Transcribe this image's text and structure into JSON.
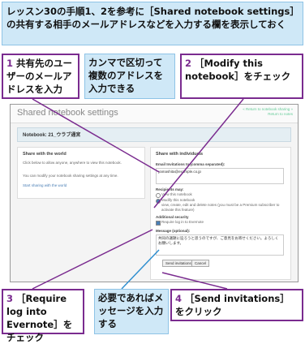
{
  "intro": "レッスン30の手順1、2を参考に［Shared notebook settings］の共有する相手のメールアドレスなどを入力する欄を表示しておく",
  "callouts": {
    "c1": {
      "num": "1",
      "text": "共有先のユーザーのメールアドレスを入力"
    },
    "blue1": "カンマで区切って複数のアドレスを入力できる",
    "c2": {
      "num": "2",
      "text": "［Modify this notebook］をチェック"
    },
    "c3": {
      "num": "3",
      "text": "［Require log into Evernote］をチェック"
    },
    "blue2": "必要であればメッセージを入力する",
    "c4": {
      "num": "4",
      "text": "［Send invitations］をクリック"
    }
  },
  "screenshot": {
    "title": "Shared notebook settings",
    "links": [
      "« Return to notebook sharing »",
      "Return to notes"
    ],
    "notebook_label": "Notebook: 21_ウラブ通宮",
    "world": {
      "heading": "Share with the world",
      "desc": "Click below to allow anyone, anywhere to view this notebook.",
      "note": "You can modify your notebook sharing settings at any time.",
      "button": "Start sharing with the world"
    },
    "individuals": {
      "heading": "Share with individuals",
      "email_label": "Email Invitations to (comma separated):",
      "email_value": "yamashita@example.co.jp",
      "recipients_label": "Recipients may:",
      "opt_view": "View this notebook",
      "opt_modify": "Modify this notebook",
      "opt_modify_desc": "view, create, edit and delete notes (you must be a Premium subscriber to activate this feature)",
      "security_label": "Additional security",
      "require_login": "Require log in to Evernote",
      "message_label": "Message (optional):",
      "message_value": "共同の議題に迫ろうと思うのですが、ご意見をお寄せください。よろしくお願いします。",
      "send_button": "Send invitations",
      "cancel_button": "Cancel"
    }
  }
}
